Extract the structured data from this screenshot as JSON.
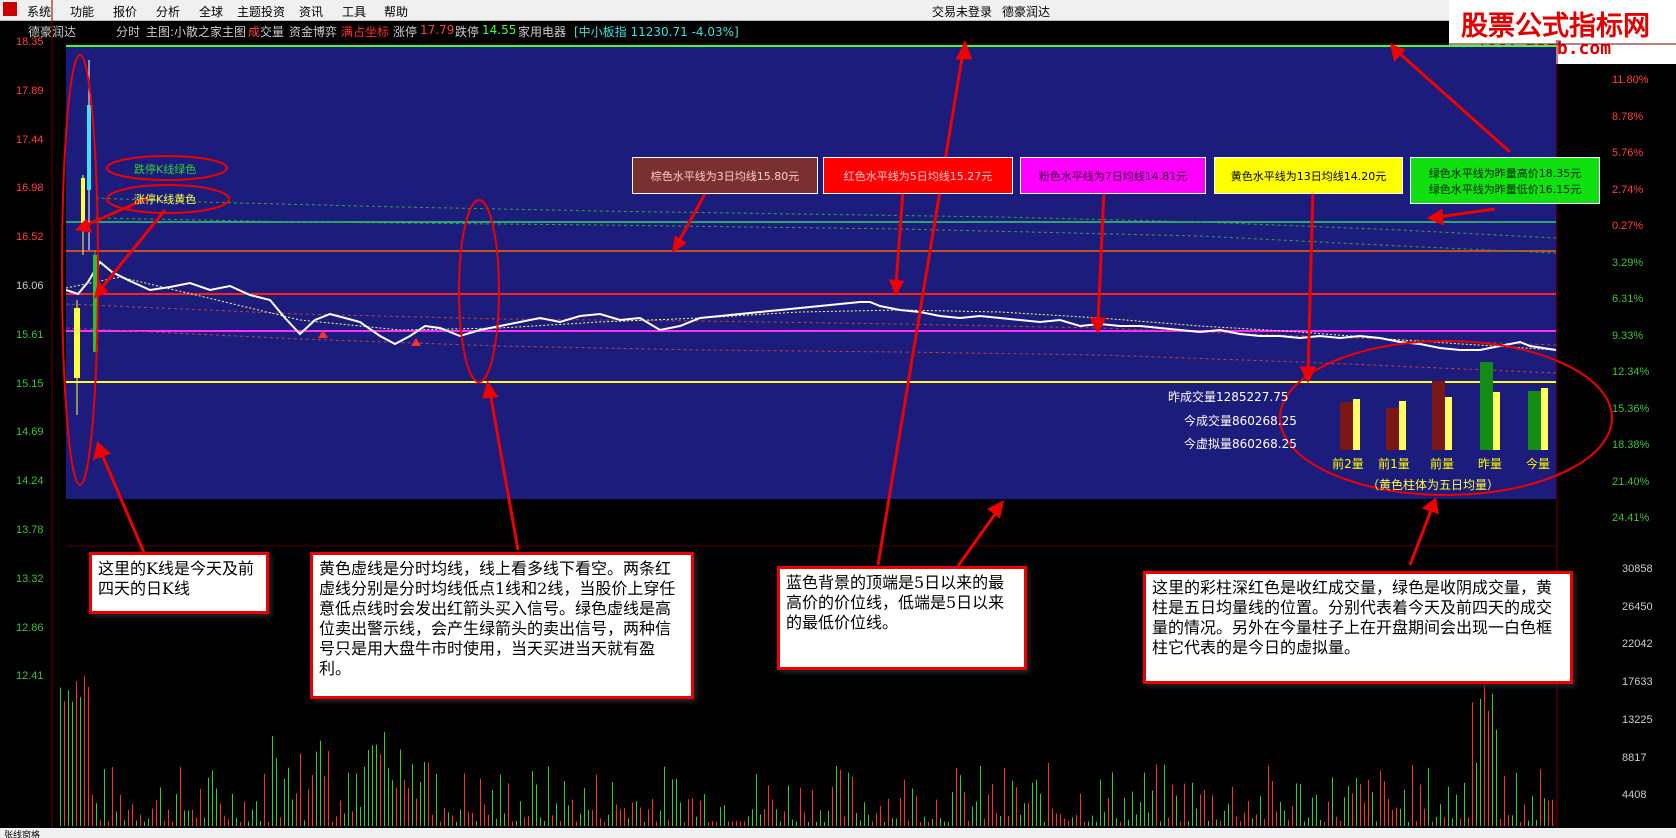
{
  "menu": {
    "items": [
      "系统",
      "功能",
      "报价",
      "分析",
      "全球",
      "主题投资",
      "资讯",
      "工具",
      "帮助"
    ],
    "center_status": "交易未登录",
    "center_stock": "德豪润达"
  },
  "watermark": {
    "title": "股票公式指标网",
    "url": "www.gszb.com"
  },
  "infobar": {
    "stock": "德豪润达",
    "mode": "分时",
    "main_chart": "主图:小散之家主图",
    "volume_label_a": "成",
    "volume_label_b": "交量",
    "capital_game": "资金博弈",
    "overlay": "满占坐标",
    "limit_up_label": "涨停",
    "limit_up_value": "17.79",
    "limit_down_label": "跌停",
    "limit_down_value": "14.55",
    "sector": "家用电器",
    "index_text": "[中小板指 11230.71 -4.03%]"
  },
  "axis": {
    "left_prices": [
      "18.35",
      "17.89",
      "17.44",
      "16.98",
      "16.52",
      "16.06",
      "15.61",
      "15.15",
      "14.69",
      "14.24",
      "13.78",
      "13.32",
      "12.86",
      "12.41"
    ],
    "right_pcts": [
      "11.80%",
      "8.78%",
      "5.76%",
      "2.74%",
      "0.27%",
      "3.29%",
      "6.31%",
      "9.33%",
      "12.34%",
      "15.36%",
      "18.38%",
      "21.40%",
      "24.41%"
    ],
    "right_volumes": [
      "30858",
      "26450",
      "22042",
      "17633",
      "13225",
      "8817",
      "4408"
    ]
  },
  "legend_boxes": [
    {
      "text": "棕色水平线为3日均线15.80元",
      "bg": "#7a3030",
      "fg": "#ffcccc"
    },
    {
      "text": "红色水平线为5日均线15.27元",
      "bg": "#ff0000",
      "fg": "#ffcccc"
    },
    {
      "text": "粉色水平线为7日均线14.81元",
      "bg": "#ff00ff",
      "fg": "#330033"
    },
    {
      "text": "黄色水平线为13日均线14.20元",
      "bg": "#ffff00",
      "fg": "#000000"
    }
  ],
  "legend_green": {
    "line1": "绿色水平线为昨量高价18.35元",
    "line2": "绿色水平线为昨量低价16.15元"
  },
  "volume_info": {
    "yesterday": "昨成交量1285227.75",
    "today": "今成交量860268.25",
    "virtual": "今虚拟量860268.25"
  },
  "volume_bars": {
    "labels": [
      "前2量",
      "前1量",
      "前量",
      "昨量",
      "今量"
    ],
    "note": "（黄色柱体为五日均量）"
  },
  "ellipse_labels": {
    "green": "跌停K线绿色",
    "yellow": "涨停K线黄色"
  },
  "annotations": {
    "kline": "这里的K线是今天及前四天的日K线",
    "avgline": "黄色虚线是分时均线，线上看多线下看空。两条红虚线分别是分时均线低点1线和2线，当股价上穿任意低点线时会发出红箭头买入信号。绿色虚线是高位卖出警示线，会产生绿箭头的卖出信号，两种信号只是用大盘牛市时使用，当天买进当天就有盈利。",
    "bluebg": "蓝色背景的顶端是5日以来的最高价的价位线，低端是5日以来的最低价位线。",
    "colbars": "这里的彩柱深红色是收红成交量，绿色是收阴成交量，黄柱是五日均量线的位置。分别代表着今天及前四天的成交量的情况。另外在今量柱子上在开盘期间会出现一白色框柱它代表的是今日的虚拟量。"
  },
  "statusbar": {
    "text": "张线窗格"
  },
  "colors": {
    "panel_bg": "#1c1c7c",
    "accent_red": "#e00000",
    "ma3": "#c0502a",
    "ma5": "#ff2020",
    "ma7": "#ff30ff",
    "ma13": "#ffff30",
    "hi_lo": "#20c040"
  }
}
